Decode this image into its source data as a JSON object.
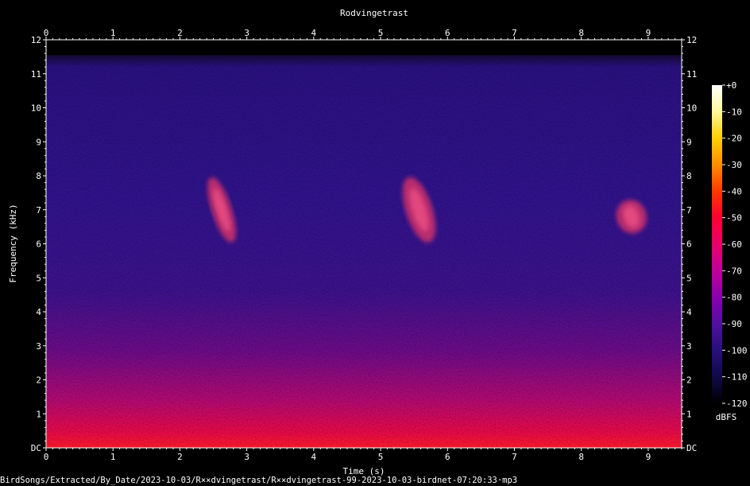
{
  "chart_data": {
    "type": "heatmap",
    "title": "Rodvingetrast",
    "xlabel": "Time (s)",
    "ylabel": "Frequency (kHz)",
    "xlim": [
      0,
      9.5
    ],
    "ylim": [
      0,
      12
    ],
    "x_ticks": [
      "0",
      "1",
      "2",
      "3",
      "4",
      "5",
      "6",
      "7",
      "8",
      "9"
    ],
    "y_ticks": [
      "DC",
      "1",
      "2",
      "3",
      "4",
      "5",
      "6",
      "7",
      "8",
      "9",
      "10",
      "11",
      "12"
    ],
    "colorbar": {
      "label": "dBFS",
      "range": [
        -120,
        0
      ],
      "ticks": [
        "+0",
        "-10",
        "-20",
        "-30",
        "-40",
        "-50",
        "-60",
        "-70",
        "-80",
        "-90",
        "-100",
        "-110",
        "-120"
      ],
      "colors": [
        "#ffffff",
        "#fff7a0",
        "#ffd000",
        "#ff8c00",
        "#ff3a00",
        "#ff0030",
        "#e8006a",
        "#c0009a",
        "#8a00b0",
        "#5010a0",
        "#28107a",
        "#100a48",
        "#000000"
      ]
    },
    "bursts": [
      {
        "start_s": 2.5,
        "end_s": 2.75,
        "low_khz": 6.0,
        "high_khz": 8.0
      },
      {
        "start_s": 5.4,
        "end_s": 5.75,
        "low_khz": 6.0,
        "high_khz": 8.0
      },
      {
        "start_s": 8.55,
        "end_s": 8.95,
        "low_khz": 6.3,
        "high_khz": 7.3
      }
    ]
  },
  "footer": {
    "file_path": "BirdSongs/Extracted/By_Date/2023-10-03/R××dvingetrast/R××dvingetrast-99-2023-10-03-birdnet-07:20:33·mp3"
  }
}
